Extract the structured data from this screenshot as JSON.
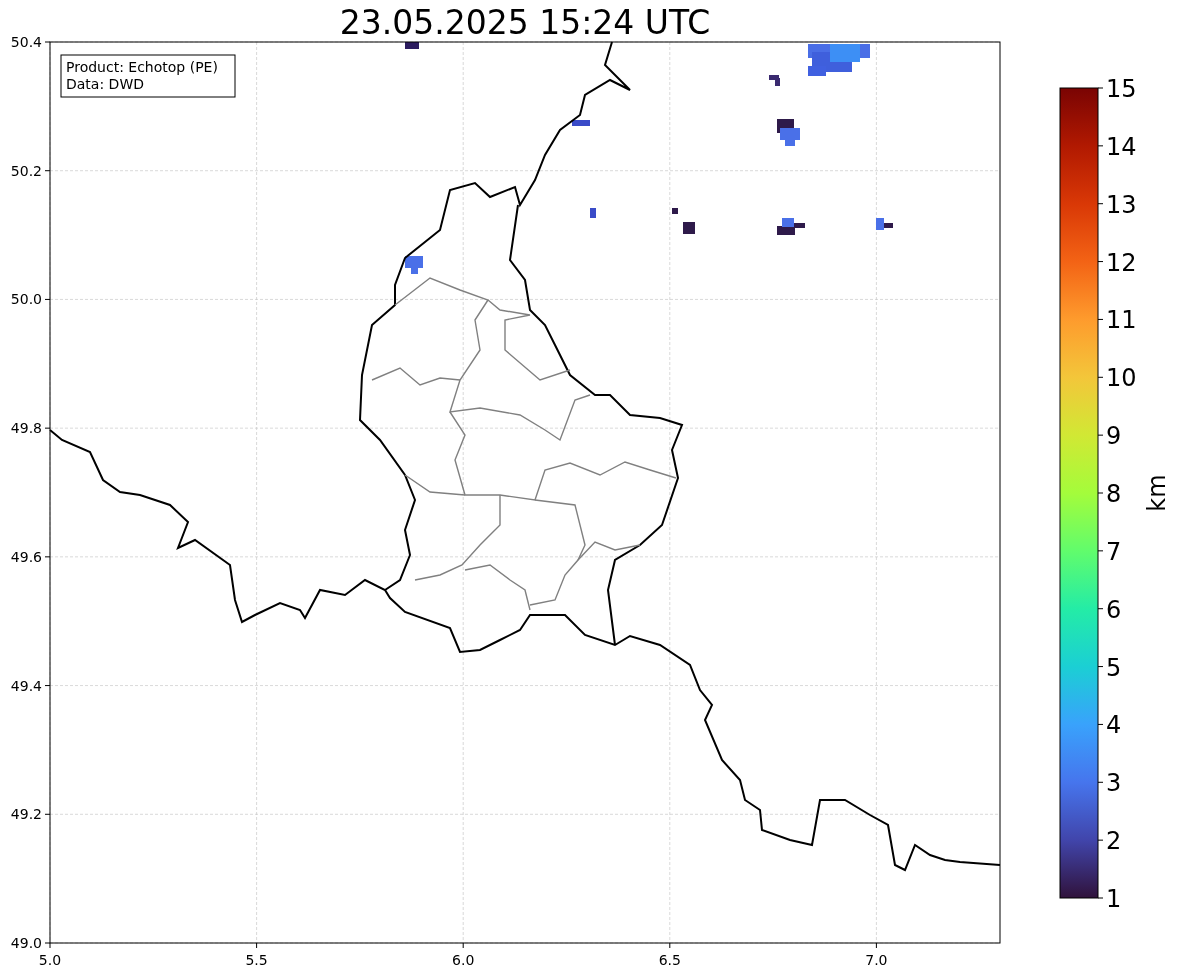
{
  "title": "23.05.2025 15:24 UTC",
  "info_box": {
    "lines": [
      "Product: Echotop (PE)",
      "Data: DWD"
    ]
  },
  "x_axis": {
    "ticks": [
      "5.0",
      "5.5",
      "6.0",
      "6.5",
      "7.0"
    ]
  },
  "y_axis": {
    "ticks": [
      "50.4",
      "50.2",
      "50.0",
      "49.8",
      "49.6",
      "49.4",
      "49.2",
      "49.0"
    ]
  },
  "colorbar": {
    "ticks": [
      "15",
      "14",
      "13",
      "12",
      "11",
      "10",
      "9",
      "8",
      "7",
      "6",
      "5",
      "4",
      "3",
      "2",
      "1"
    ],
    "label": "km"
  }
}
